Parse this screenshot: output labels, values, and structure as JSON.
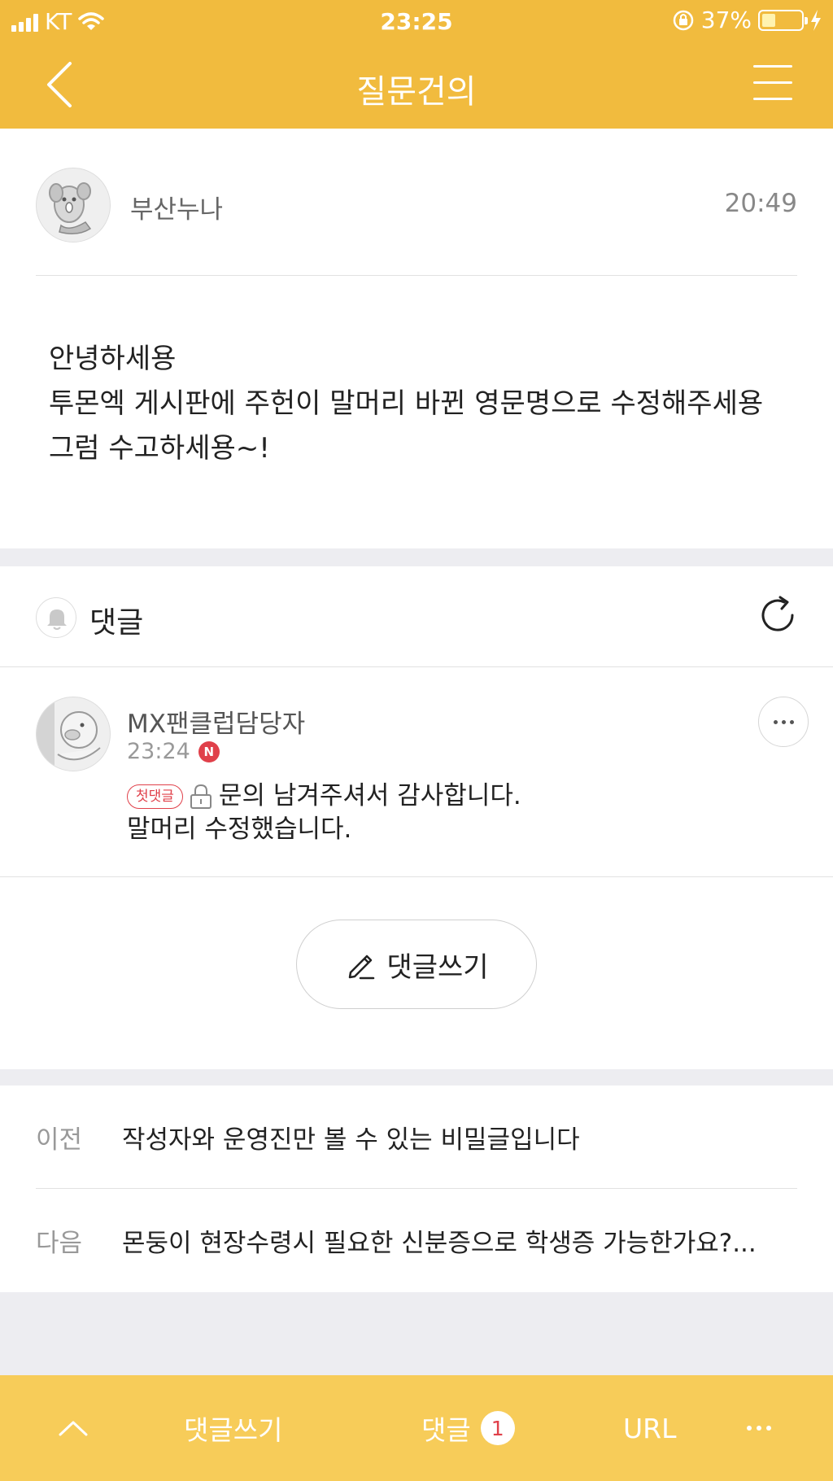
{
  "status_bar": {
    "carrier": "KT",
    "time": "23:25",
    "battery": "37%"
  },
  "header": {
    "title": "질문건의",
    "back_icon": "chevron-left-icon",
    "menu_icon": "hamburger-menu-icon"
  },
  "post": {
    "author": "부산누나",
    "time": "20:49",
    "body": [
      "안녕하세용",
      "투몬엑 게시판에 주헌이 말머리 바뀐 영문명으로 수정해주세용",
      "그럼 수고하세용~!"
    ]
  },
  "comments": {
    "title": "댓글",
    "items": [
      {
        "author": "MX팬클럽담당자",
        "time": "23:24",
        "new_badge": "N",
        "tag": "첫댓글",
        "text_line1": "문의 남겨주셔서 감사합니다.",
        "text_line2": "말머리 수정했습니다."
      }
    ],
    "write_button": "댓글쓰기"
  },
  "post_nav": {
    "prev_label": "이전",
    "prev_title": "작성자와 운영진만 볼 수 있는 비밀글입니다",
    "next_label": "다음",
    "next_title": "몬둥이 현장수령시 필요한 신분증으로 학생증 가능한가요?..."
  },
  "bottom_bar": {
    "write": "댓글쓰기",
    "comments": "댓글",
    "comment_count": "1",
    "url": "URL"
  },
  "colors": {
    "header": "#f1bb3e",
    "bottom_bar": "#f7cc59",
    "accent_red": "#e0404a"
  }
}
